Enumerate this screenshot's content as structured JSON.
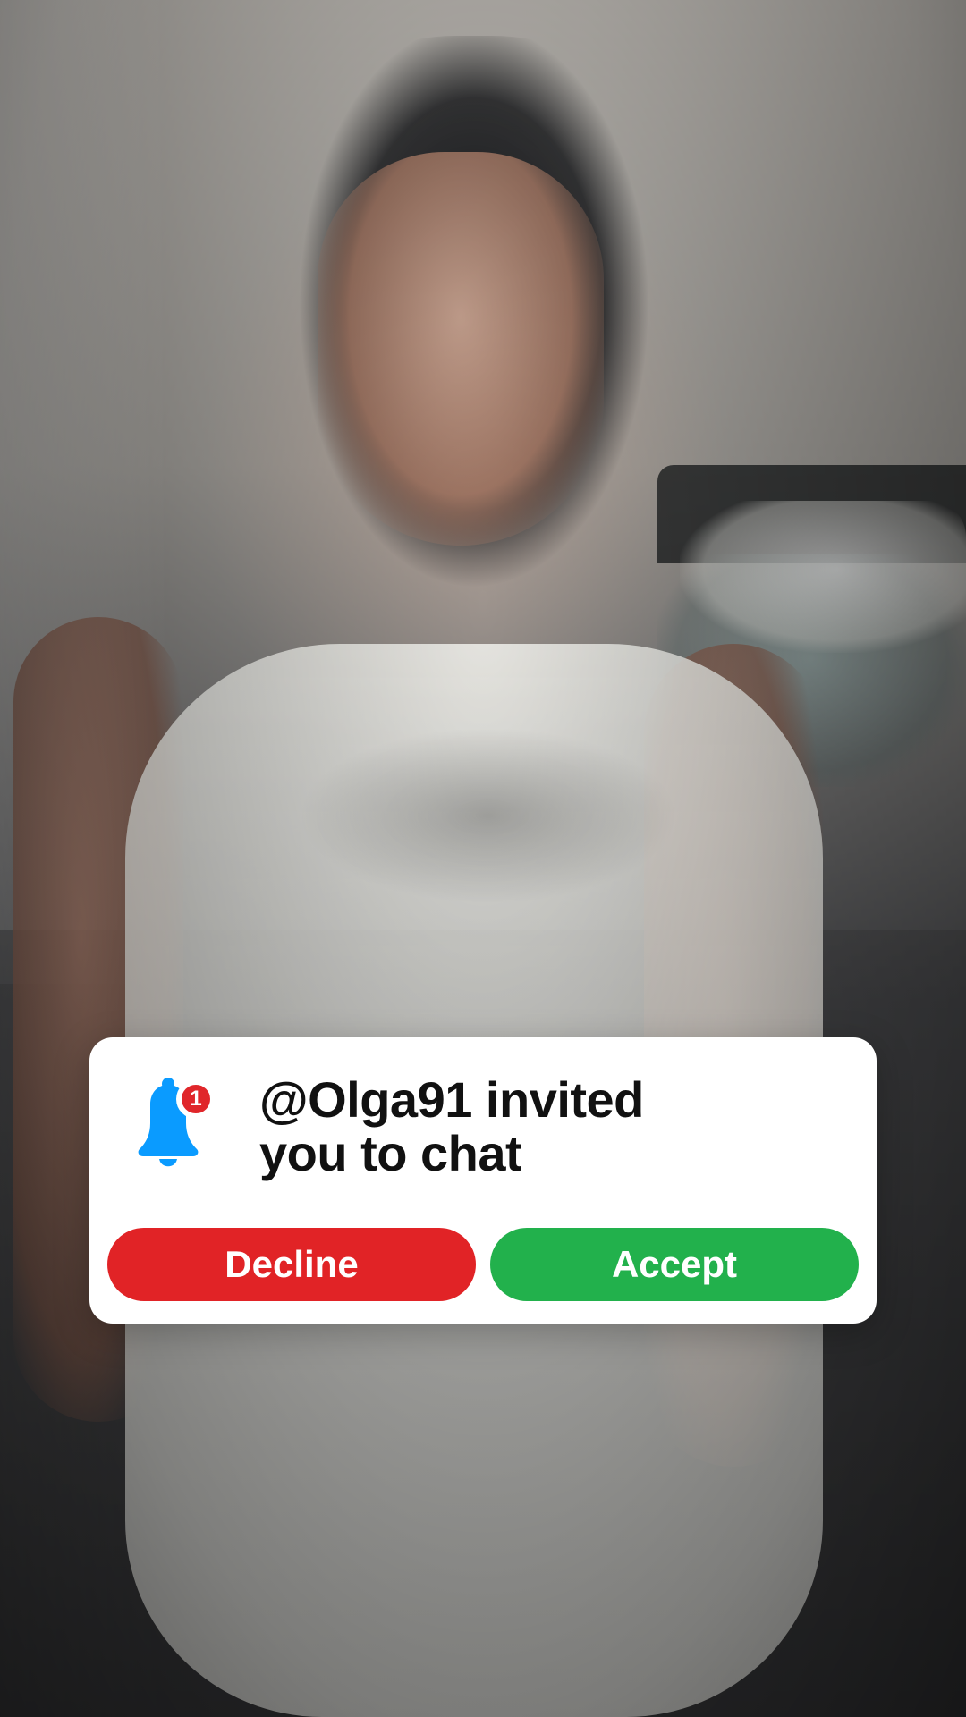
{
  "notification": {
    "badge_count": "1",
    "message_line1": "@Olga91 invited",
    "message_line2": "you to chat",
    "decline_label": "Decline",
    "accept_label": "Accept",
    "icon": "bell-icon",
    "colors": {
      "bell": "#0A9BFF",
      "badge": "#E0262A",
      "decline": "#E12326",
      "accept": "#22B14C",
      "card_bg": "#FFFFFF",
      "text": "#111111"
    }
  }
}
